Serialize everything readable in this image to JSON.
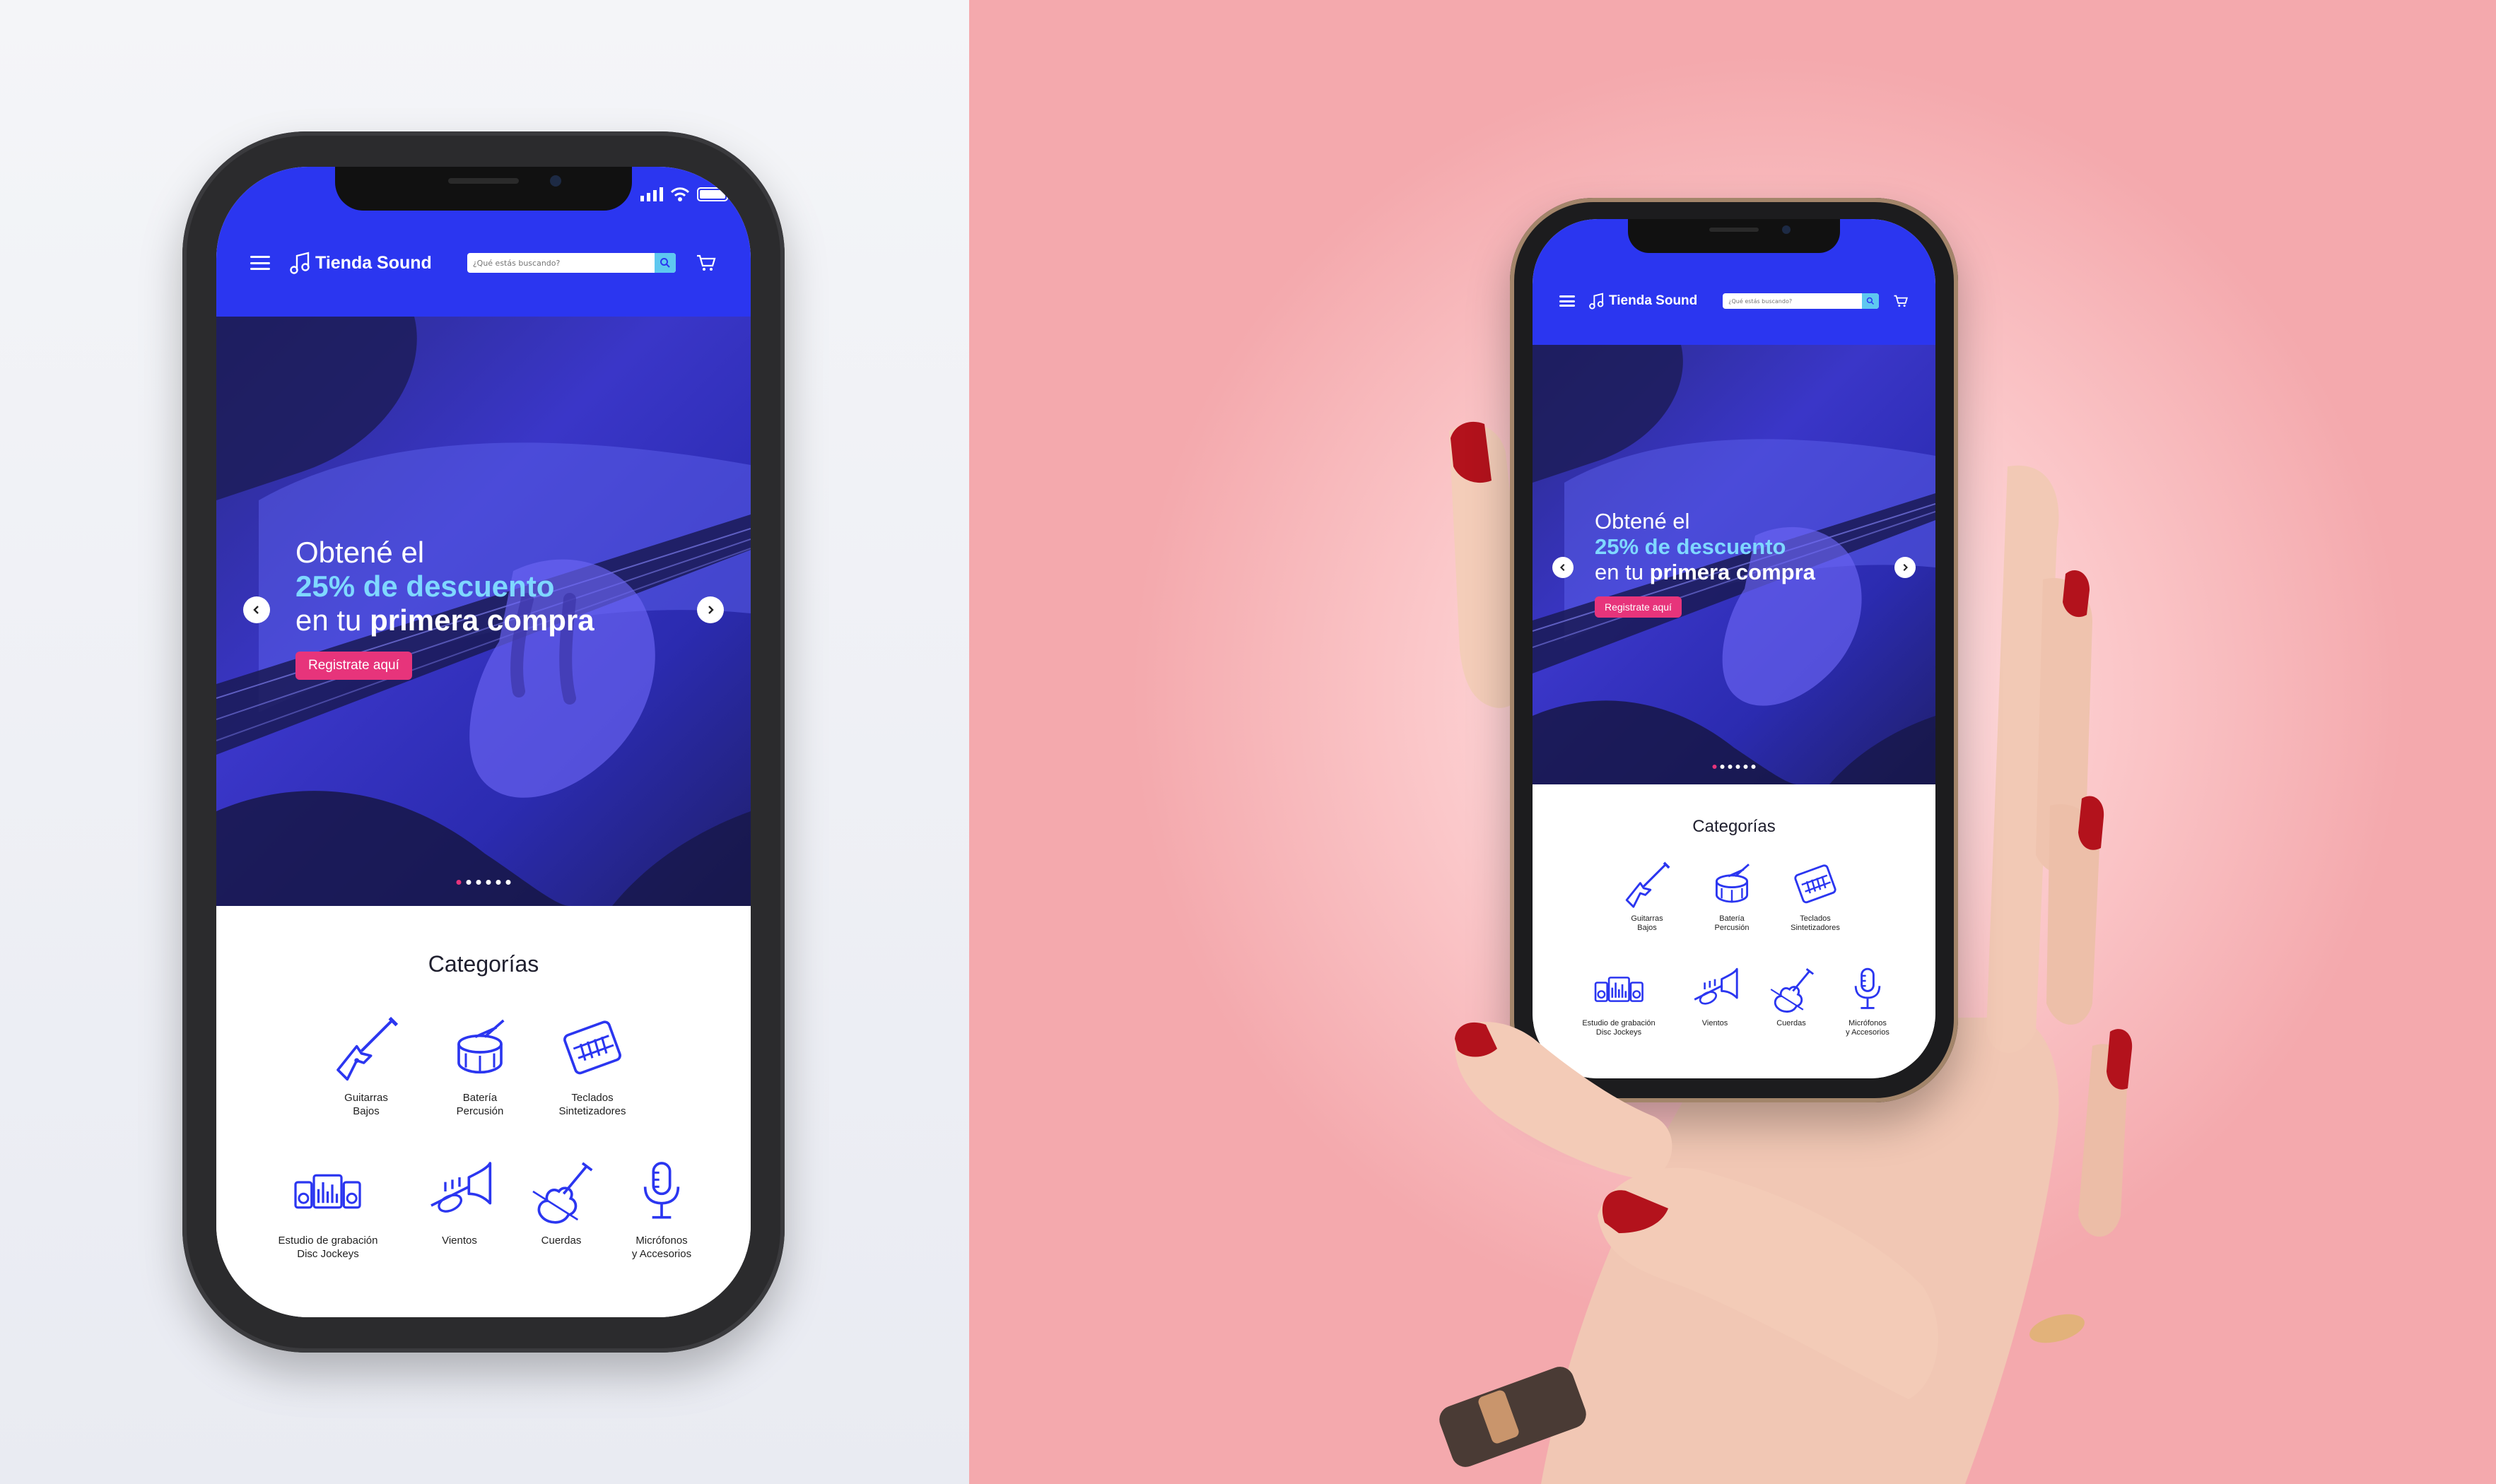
{
  "header": {
    "brand": "Tienda Sound",
    "search_placeholder": "¿Qué estás buscando?",
    "menu_icon": "hamburger-menu-icon",
    "search_icon": "search-icon",
    "cart_icon": "cart-icon",
    "logo_icon": "music-note-icon"
  },
  "hero": {
    "line1": "Obtené el",
    "line2": "25% de descuento",
    "line3_prefix": "en tu",
    "line3_bold": "primera compra",
    "cta": "Registrate aquí",
    "slide_count": 6,
    "active_slide": 1
  },
  "categories": {
    "title": "Categorías",
    "items": [
      {
        "line1": "Guitarras",
        "line2": "Bajos",
        "icon": "electric-guitar-icon"
      },
      {
        "line1": "Batería",
        "line2": "Percusión",
        "icon": "drum-icon"
      },
      {
        "line1": "Teclados",
        "line2": "Sintetizadores",
        "icon": "keyboard-icon"
      },
      {
        "line1": "Estudio de grabación",
        "line2": "Disc Jockeys",
        "icon": "studio-speakers-icon"
      },
      {
        "line1": "Vientos",
        "line2": "",
        "icon": "trumpet-icon"
      },
      {
        "line1": "Cuerdas",
        "line2": "",
        "icon": "violin-icon"
      },
      {
        "line1": "Micrófonos",
        "line2": "y Accesorios",
        "icon": "microphone-icon"
      }
    ]
  },
  "colors": {
    "brand_blue": "#2b36f0",
    "accent_pink": "#e7347b",
    "highlight_cyan": "#7fd8ff",
    "icon_blue": "#2b36f0",
    "left_background": "#eef0f5",
    "right_background": "#fbc7c9"
  }
}
